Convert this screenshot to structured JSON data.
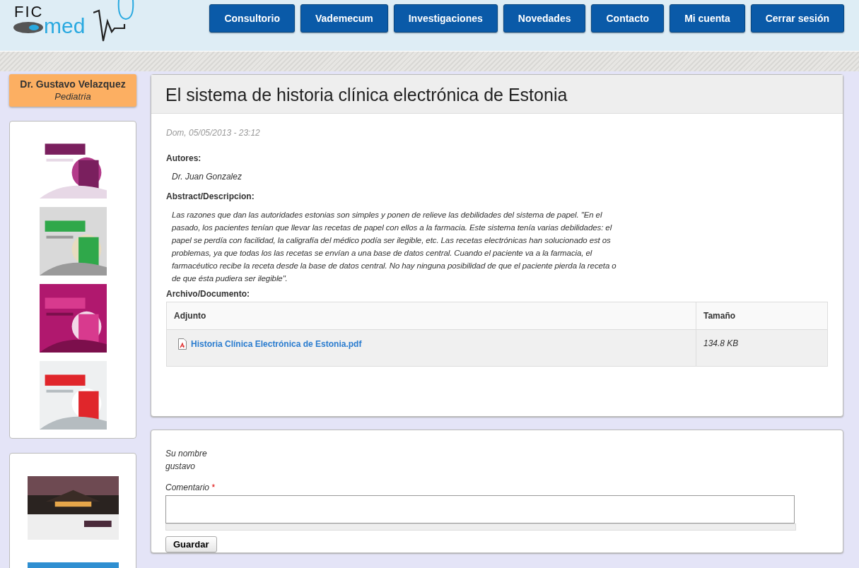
{
  "logo": {
    "top": "FIC",
    "bottom": "med"
  },
  "nav": [
    {
      "label": "Consultorio"
    },
    {
      "label": "Vademecum"
    },
    {
      "label": "Investigaciones"
    },
    {
      "label": "Novedades"
    },
    {
      "label": "Contacto"
    },
    {
      "label": "Mi cuenta"
    },
    {
      "label": "Cerrar sesión"
    }
  ],
  "sidebar": {
    "profile": {
      "name": "Dr. Gustavo Velazquez",
      "specialty": "Pediatria"
    }
  },
  "article": {
    "title": "El sistema de historia clínica electrónica de Estonia",
    "date": "Dom, 05/05/2013 - 23:12",
    "authors_label": "Autores:",
    "authors": "Dr. Juan Gonzalez",
    "abstract_label": "Abstract/Descripcion:",
    "abstract": "Las razones que dan las autoridades estonias son simples y ponen de relieve las debilidades del sistema de papel. \"En el pasado, los pacientes tenían que llevar las recetas de papel con ellos a la farmacia. Este sistema tenía varias debilidades: el papel se perdía con facilidad, la caligrafía del médico podía ser ilegible, etc. Las recetas electrónicas han solucionado est os problemas, ya que todas los las recetas se envían a una base de datos central. Cuando el paciente va a la farmacia, el farmacéutico recibe la receta desde la base de datos central. No hay ninguna posibilidad de que el paciente pierda la receta o de que ésta pudiera ser ilegible\".",
    "files_label": "Archivo/Documento:",
    "table": {
      "columns": [
        "Adjunto",
        "Tamaño"
      ],
      "rows": [
        {
          "file": "Historia Clínica Electrónica de Estonia.pdf",
          "size": "134.8 KB"
        }
      ]
    }
  },
  "comment_form": {
    "name_label": "Su nombre",
    "name_value": "gustavo",
    "comment_label": "Comentario",
    "required_mark": "*",
    "submit": "Guardar"
  }
}
